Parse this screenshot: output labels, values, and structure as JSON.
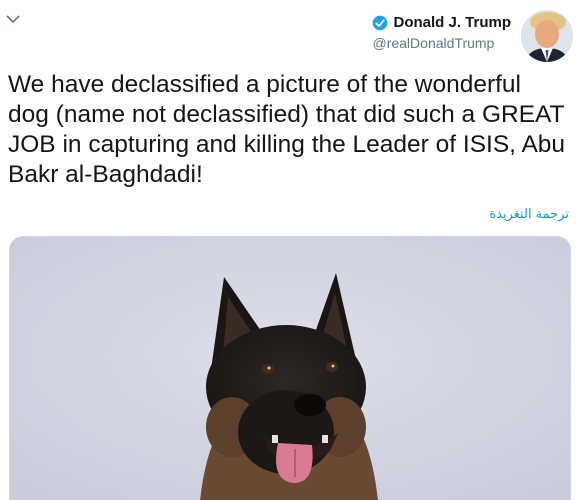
{
  "tweet": {
    "author": {
      "name": "Donald J. Trump",
      "handle": "@realDonaldTrump",
      "verified": true
    },
    "text": "We have declassified a picture of the wonderful dog (name not declassified) that did such a GREAT JOB in capturing and killing the Leader of ISIS, Abu Bakr al-Baghdadi!",
    "translate_label": "ترجمة التغريدة"
  },
  "icons": {
    "menu": "chevron-down-icon",
    "verified": "verified-badge-icon"
  },
  "colors": {
    "link": "#1b95e0",
    "verified_badge": "#1da1f2",
    "handle": "#657786",
    "text": "#14171a"
  }
}
